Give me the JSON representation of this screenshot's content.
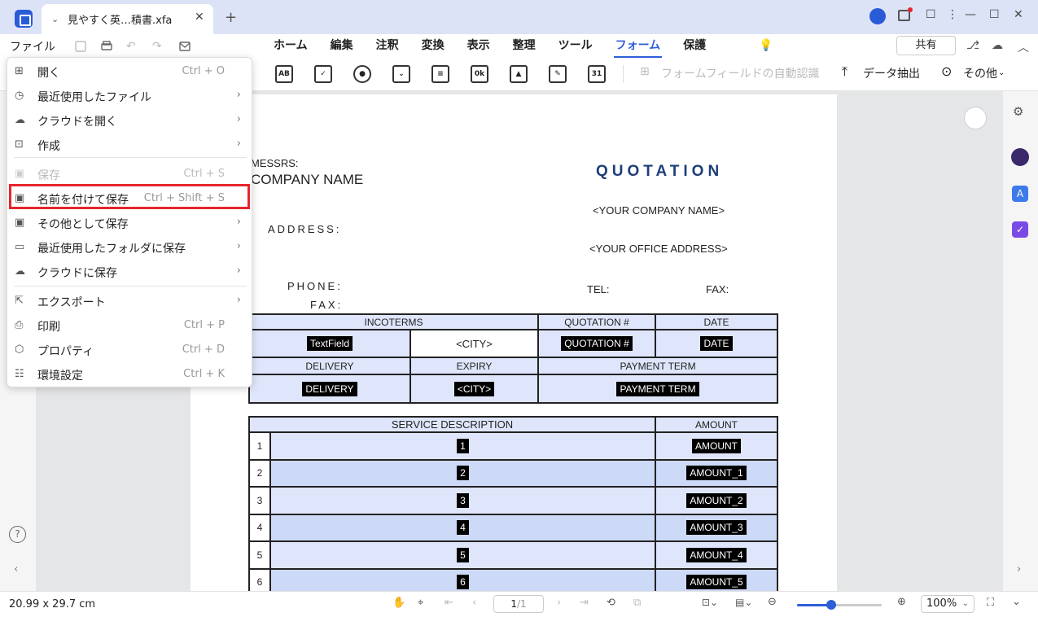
{
  "tab": {
    "title": "見やすく英…積書.xfa"
  },
  "menubar": {
    "file": "ファイル",
    "tabs": [
      "ホーム",
      "編集",
      "注釈",
      "変換",
      "表示",
      "整理",
      "ツール",
      "フォーム",
      "保護"
    ],
    "share": "共有"
  },
  "toolbar": {
    "auto_detect": "フォームフィールドの自動認識",
    "extract": "データ抽出",
    "more": "その他",
    "icons": {
      "text": "AB",
      "check": "✓",
      "radio": "●",
      "combo": "⌄",
      "list": "≡",
      "ok": "0k",
      "image": "▲",
      "sign": "✎",
      "date": "31"
    }
  },
  "file_menu": {
    "items": [
      {
        "label": "開く",
        "shortcut": "Ctrl + O"
      },
      {
        "label": "最近使用したファイル"
      },
      {
        "label": "クラウドを開く"
      },
      {
        "label": "作成"
      },
      {
        "label": "保存",
        "shortcut": "Ctrl + S"
      },
      {
        "label": "名前を付けて保存",
        "shortcut": "Ctrl + Shift + S"
      },
      {
        "label": "その他として保存"
      },
      {
        "label": "最近使用したフォルダに保存"
      },
      {
        "label": "クラウドに保存"
      },
      {
        "label": "エクスポート"
      },
      {
        "label": "印刷",
        "shortcut": "Ctrl + P"
      },
      {
        "label": "プロパティ",
        "shortcut": "Ctrl + D"
      },
      {
        "label": "環境設定",
        "shortcut": "Ctrl + K"
      }
    ]
  },
  "document": {
    "messrs": "MESSRS:",
    "company_name": "COMPANY NAME",
    "quotation_title": "QUOTATION",
    "your_company": "<YOUR COMPANY NAME>",
    "address_label": "ADDRESS:",
    "office_address": "<YOUR OFFICE ADDRESS>",
    "phone_label": "PHONE:",
    "fax_label": "FAX:",
    "tel_label": "TEL:",
    "fax_right": "FAX:",
    "table1": {
      "incoterms": "INCOTERMS",
      "quotation_no": "QUOTATION #",
      "date": "DATE",
      "textfield": "TextField",
      "city": "<CITY>",
      "quotation_field": "QUOTATION #",
      "date_field": "DATE",
      "delivery": "DELIVERY",
      "expiry": "EXPIRY",
      "payment_term": "PAYMENT TERM",
      "delivery_field": "DELIVERY",
      "city_field": "<CITY>",
      "payment_field": "PAYMENT TERM"
    },
    "table2": {
      "service_desc": "SERVICE DESCRIPTION",
      "amount": "AMOUNT",
      "rows": [
        {
          "n": "1",
          "desc": "1",
          "amount": "AMOUNT"
        },
        {
          "n": "2",
          "desc": "2",
          "amount": "AMOUNT_1"
        },
        {
          "n": "3",
          "desc": "3",
          "amount": "AMOUNT_2"
        },
        {
          "n": "4",
          "desc": "4",
          "amount": "AMOUNT_3"
        },
        {
          "n": "5",
          "desc": "5",
          "amount": "AMOUNT_4"
        },
        {
          "n": "6",
          "desc": "6",
          "amount": "AMOUNT_5"
        }
      ]
    }
  },
  "status": {
    "size": "20.99 x 29.7 cm",
    "page": "1",
    "total": "/1",
    "zoom": "100%"
  },
  "colors": {
    "accent": "#2f5fd8",
    "highlight": "#e6262c",
    "cell": "#dfe6fb",
    "cell_alt": "#ccd9f7"
  }
}
